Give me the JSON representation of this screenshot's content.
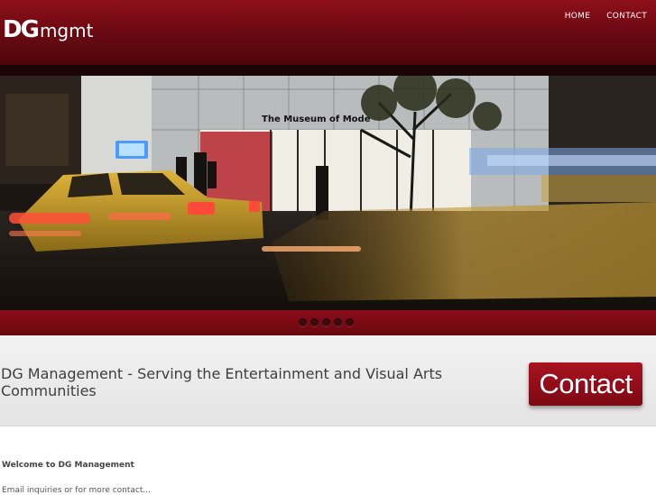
{
  "header": {
    "logo_bold": "DG",
    "logo_light": "mgmt",
    "nav": [
      {
        "label": "HOME"
      },
      {
        "label": "CONTACT"
      }
    ]
  },
  "slider": {
    "photo_sign": "The Museum of Mode",
    "dots": 5
  },
  "tagline": {
    "text": "DG Management - Serving the Entertainment and Visual Arts Communities",
    "contact_button": "Contact"
  },
  "content": {
    "welcome_heading": "Welcome to DG Management",
    "body_text": "Email inquiries or for more contact..."
  },
  "colors": {
    "brand_maroon": "#8e0f1a",
    "tagline_text": "#3e3e3e"
  }
}
